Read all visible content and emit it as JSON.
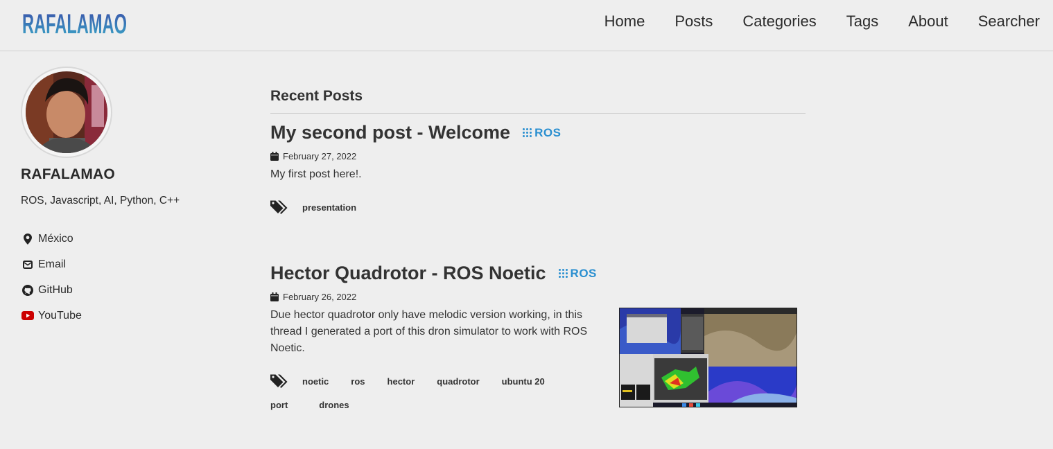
{
  "header": {
    "logo_text": "RAFALAMAO",
    "nav": [
      "Home",
      "Posts",
      "Categories",
      "Tags",
      "About",
      "Searcher"
    ]
  },
  "sidebar": {
    "name": "RAFALAMAO",
    "bio": "ROS, Javascript, AI, Python, C++",
    "links": [
      {
        "label": "México",
        "icon": "map-marker-icon"
      },
      {
        "label": "Email",
        "icon": "envelope-icon"
      },
      {
        "label": "GitHub",
        "icon": "github-icon"
      },
      {
        "label": "YouTube",
        "icon": "youtube-icon"
      }
    ]
  },
  "main": {
    "section_title": "Recent Posts",
    "posts": [
      {
        "title": "My second post - Welcome",
        "badge": "ROS",
        "date": "February 27, 2022",
        "excerpt": "My first post here!.",
        "tags": [
          "presentation"
        ]
      },
      {
        "title": "Hector Quadrotor - ROS Noetic",
        "badge": "ROS",
        "date": "February 26, 2022",
        "excerpt": "Due hector quadrotor only have melodic version working, in this thread I generated a port of this dron simulator to work with ROS Noetic.",
        "tags": [
          "noetic",
          "ros",
          "hector",
          "quadrotor",
          "ubuntu 20",
          "port",
          "drones"
        ]
      }
    ]
  },
  "colors": {
    "background": "#eeeeee",
    "ros_blue": "#2a8fd0",
    "youtube_red": "#cc0000",
    "logo_gradient_top": "#3a4fa8",
    "logo_gradient_bottom": "#3aa8c8"
  }
}
